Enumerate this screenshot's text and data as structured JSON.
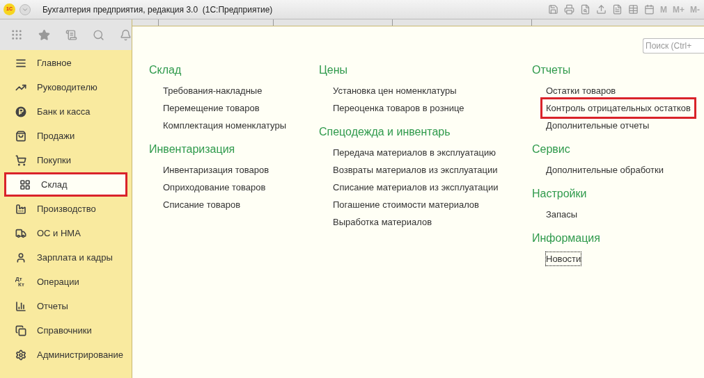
{
  "window": {
    "title": "Бухгалтерия предприятия, редакция 3.0  (1С:Предприятие)",
    "logo": "1С",
    "toolbar_texts": [
      "M",
      "M+",
      "M-"
    ]
  },
  "sidebar": {
    "items": [
      {
        "label": "Главное",
        "kind": "menu",
        "selected": false,
        "highlighted": false
      },
      {
        "label": "Руководителю",
        "kind": "trend",
        "selected": false,
        "highlighted": false
      },
      {
        "label": "Банк и касса",
        "kind": "ruble",
        "selected": false,
        "highlighted": false
      },
      {
        "label": "Продажи",
        "kind": "bag",
        "selected": false,
        "highlighted": false
      },
      {
        "label": "Покупки",
        "kind": "cart",
        "selected": false,
        "highlighted": false
      },
      {
        "label": "Склад",
        "kind": "grid",
        "selected": true,
        "highlighted": true
      },
      {
        "label": "Производство",
        "kind": "factory",
        "selected": false,
        "highlighted": false
      },
      {
        "label": "ОС и НМА",
        "kind": "truck",
        "selected": false,
        "highlighted": false
      },
      {
        "label": "Зарплата и кадры",
        "kind": "person",
        "selected": false,
        "highlighted": false
      },
      {
        "label": "Операции",
        "kind": "dtkt",
        "icon_text": [
          "Дт",
          "Кт"
        ],
        "selected": false,
        "highlighted": false
      },
      {
        "label": "Отчеты",
        "kind": "chart",
        "selected": false,
        "highlighted": false
      },
      {
        "label": "Справочники",
        "kind": "books",
        "selected": false,
        "highlighted": false
      },
      {
        "label": "Администрирование",
        "kind": "gear",
        "selected": false,
        "highlighted": false
      }
    ]
  },
  "search": {
    "placeholder": "Поиск (Ctrl+"
  },
  "columns": [
    [
      {
        "title": "Склад",
        "links": [
          {
            "label": "Требования-накладные",
            "highlighted": false,
            "focused": false
          },
          {
            "label": "Перемещение товаров",
            "highlighted": false,
            "focused": false
          },
          {
            "label": "Комплектация номенклатуры",
            "highlighted": false,
            "focused": false
          }
        ]
      },
      {
        "title": "Инвентаризация",
        "links": [
          {
            "label": "Инвентаризация товаров",
            "highlighted": false,
            "focused": false
          },
          {
            "label": "Оприходование товаров",
            "highlighted": false,
            "focused": false
          },
          {
            "label": "Списание товаров",
            "highlighted": false,
            "focused": false
          }
        ]
      }
    ],
    [
      {
        "title": "Цены",
        "links": [
          {
            "label": "Установка цен номенклатуры",
            "highlighted": false,
            "focused": false
          },
          {
            "label": "Переоценка товаров в рознице",
            "highlighted": false,
            "focused": false
          }
        ]
      },
      {
        "title": "Спецодежда и инвентарь",
        "links": [
          {
            "label": "Передача материалов в эксплуатацию",
            "highlighted": false,
            "focused": false
          },
          {
            "label": "Возвраты материалов из эксплуатации",
            "highlighted": false,
            "focused": false
          },
          {
            "label": "Списание материалов из эксплуатации",
            "highlighted": false,
            "focused": false
          },
          {
            "label": "Погашение стоимости материалов",
            "highlighted": false,
            "focused": false
          },
          {
            "label": "Выработка материалов",
            "highlighted": false,
            "focused": false
          }
        ]
      }
    ],
    [
      {
        "title": "Отчеты",
        "links": [
          {
            "label": "Остатки товаров",
            "highlighted": false,
            "focused": false
          },
          {
            "label": "Контроль отрицательных остатков",
            "highlighted": true,
            "focused": false
          },
          {
            "label": "Дополнительные отчеты",
            "highlighted": false,
            "focused": false
          }
        ]
      },
      {
        "title": "Сервис",
        "links": [
          {
            "label": "Дополнительные обработки",
            "highlighted": false,
            "focused": false
          }
        ]
      },
      {
        "title": "Настройки",
        "links": [
          {
            "label": "Запасы",
            "highlighted": false,
            "focused": false
          }
        ]
      },
      {
        "title": "Информация",
        "links": [
          {
            "label": "Новости",
            "highlighted": false,
            "focused": true
          }
        ]
      }
    ]
  ]
}
